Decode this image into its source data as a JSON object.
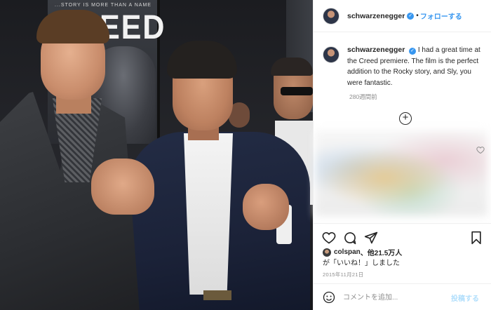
{
  "photo": {
    "poster_tagline": "...STORY IS MORE THAN A NAME",
    "poster_title": "CREED"
  },
  "header": {
    "username": "schwarzenegger",
    "separator": "•",
    "follow_label": "フォローする"
  },
  "caption": {
    "username": "schwarzenegger",
    "text": "I had a great time at the Creed premiere. The film is the perfect addition to the Rocky story, and Sly, you were fantastic.",
    "time_ago": "280週間前"
  },
  "likes": {
    "liker": "colspan",
    "others": "、他21.5万人",
    "suffix": "が「いいね！」しました"
  },
  "post_date": "2015年11月21日",
  "comment_box": {
    "placeholder": "コメントを追加...",
    "post_label": "投稿する"
  },
  "colors": {
    "accent_blue": "#3897f0",
    "post_disabled": "#b2dffc",
    "muted_text": "#8e8e8e"
  },
  "icons": [
    "heart-icon",
    "comment-icon",
    "share-icon",
    "bookmark-icon",
    "plus-circle-icon",
    "emoji-icon",
    "verified-badge-icon"
  ]
}
